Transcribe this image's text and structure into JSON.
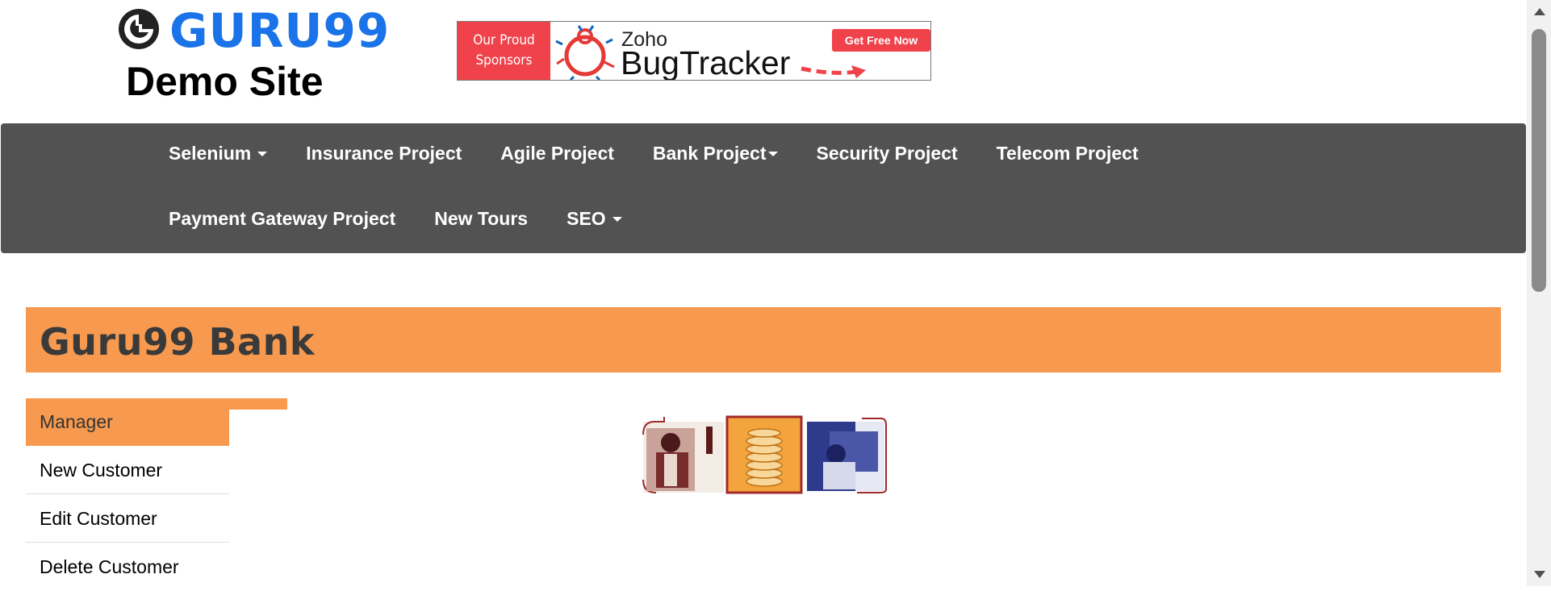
{
  "header": {
    "logo_text": "GURU99",
    "subtitle": "Demo Site"
  },
  "banner": {
    "sponsor_label": "Our Proud Sponsors",
    "brand_top": "Zoho",
    "brand_main": "BugTracker",
    "cta": "Get Free Now"
  },
  "nav": {
    "row1": [
      {
        "label": "Selenium",
        "dropdown": true
      },
      {
        "label": "Insurance Project",
        "dropdown": false
      },
      {
        "label": "Agile Project",
        "dropdown": false
      },
      {
        "label": "Bank Project",
        "dropdown": true
      },
      {
        "label": "Security Project",
        "dropdown": false
      },
      {
        "label": "Telecom Project",
        "dropdown": false
      }
    ],
    "row2": [
      {
        "label": "Payment Gateway Project",
        "dropdown": false
      },
      {
        "label": "New Tours",
        "dropdown": false
      },
      {
        "label": "SEO",
        "dropdown": true
      }
    ]
  },
  "page": {
    "title": "Guru99 Bank"
  },
  "menu": {
    "header": "Manager",
    "items": [
      "New Customer",
      "Edit Customer",
      "Delete Customer"
    ]
  },
  "colors": {
    "accent": "#f79a4f",
    "nav_bg": "#525252",
    "logo_blue": "#1a73e8",
    "banner_red": "#f0424b"
  }
}
